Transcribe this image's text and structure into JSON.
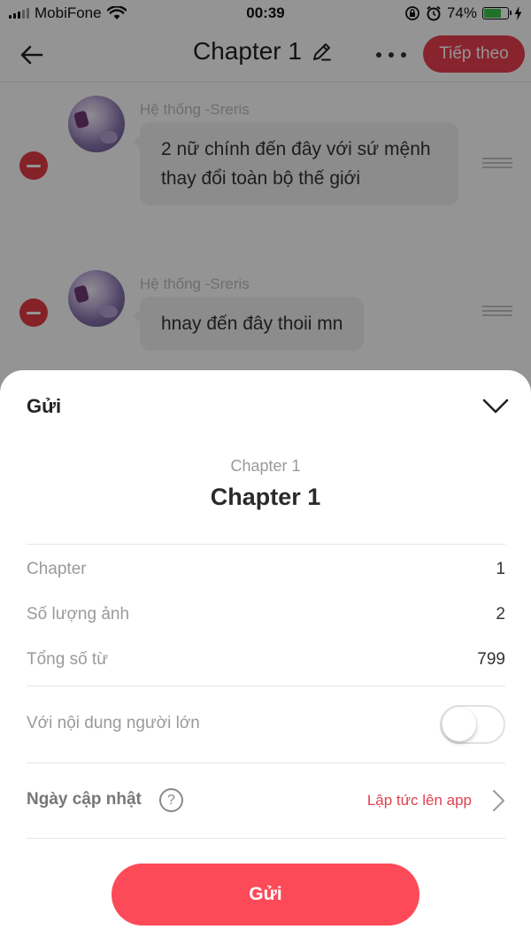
{
  "status_bar": {
    "carrier": "MobiFone",
    "time": "00:39",
    "battery_percent": "74%",
    "battery_level": 0.74,
    "icons": [
      "signal-icon",
      "wifi-icon",
      "rotation-lock-icon",
      "alarm-icon",
      "battery-icon",
      "charging-icon"
    ]
  },
  "header": {
    "title": "Chapter 1",
    "next_label": "Tiếp theo",
    "icons": [
      "back-arrow-icon",
      "pencil-icon",
      "more-icon"
    ]
  },
  "messages": [
    {
      "sender": "Hệ thống -Sreris",
      "text": "2 nữ chính đến đây với sứ mệnh thay đổi toàn bộ thế giới"
    },
    {
      "sender": "Hệ thống -Sreris",
      "text": "hnay đến đây thoii mn"
    }
  ],
  "sheet": {
    "title": "Gửi",
    "subtitle": "Chapter 1",
    "heading": "Chapter 1",
    "info": [
      {
        "label": "Chapter",
        "value": "1"
      },
      {
        "label": "Số lượng ảnh",
        "value": "2"
      },
      {
        "label": "Tổng số từ",
        "value": "799"
      }
    ],
    "adult_content_label": "Với nội dung người lớn",
    "adult_content_enabled": false,
    "update_date_label": "Ngày cập nhật",
    "update_date_value": "Lập tức lên app",
    "send_label": "Gửi",
    "help_glyph": "?"
  },
  "colors": {
    "accent": "#ea3e4f",
    "send_button": "#fd4a58",
    "remove_button": "#e43b46",
    "battery_fill": "#3bc34a"
  }
}
